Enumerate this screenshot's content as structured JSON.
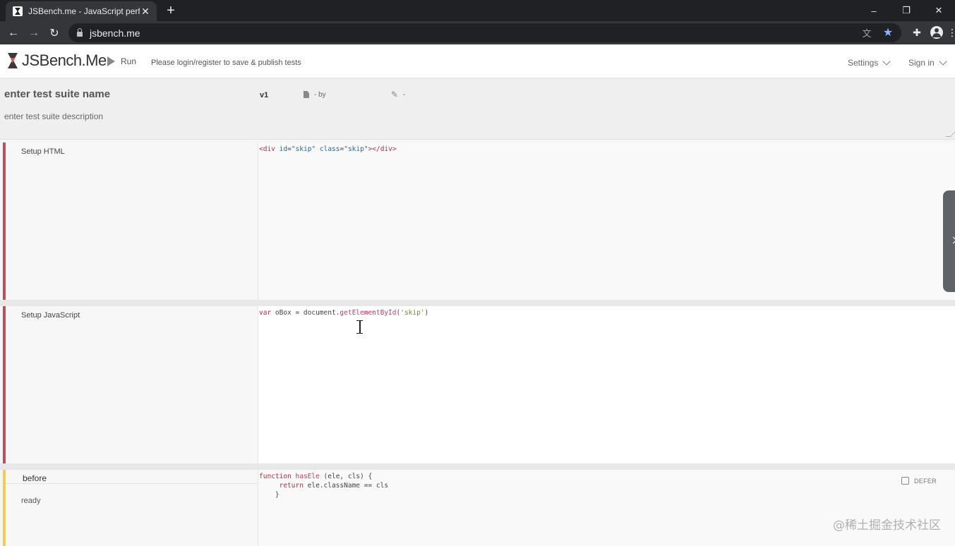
{
  "browser": {
    "tab_title": "JSBench.me - JavaScript perfo",
    "tab_close_glyph": "✕",
    "new_tab_glyph": "+",
    "url": "jsbench.me",
    "window_controls": [
      "–",
      "❐",
      "✕"
    ]
  },
  "app": {
    "logo_text": "JSBench.Me",
    "run_label": "Run",
    "login_hint": "Please login/register to save & publish tests",
    "settings_label": "Settings",
    "signin_label": "Sign in"
  },
  "suite": {
    "name_placeholder": "enter test suite name",
    "description_placeholder": "enter test suite description",
    "version": "v1",
    "by_text": "- by",
    "edit_text": "-"
  },
  "sections": {
    "setup_html": {
      "label": "Setup HTML",
      "code_html": "<span class=\"tk-tag\">&lt;div</span> <span class=\"tk-attr\">id</span>=<span class=\"tk-str\">\"skip\"</span> <span class=\"tk-attr\">class</span>=<span class=\"tk-str\">\"skip\"</span><span class=\"tk-tag\">&gt;&lt;/div&gt;</span>"
    },
    "setup_js": {
      "label": "Setup JavaScript",
      "code_html": "<span class=\"tk-kw\">var</span> oBox = document.<span class=\"tk-fn\">getElementById</span>(<span class=\"tk-str2\">'skip'</span>)"
    },
    "before": {
      "title": "before",
      "status": "ready",
      "defer_label": "DEFER",
      "code_html": "<span class=\"tk-kw\">function</span> <span class=\"tk-fn\">hasEle</span> (ele, cls) {\n     <span class=\"tk-kw\">return</span> ele.className == cls\n    }"
    }
  },
  "watermark": "@稀土掘金技术社区",
  "colors": {
    "setup_accent": "#b5525d",
    "before_accent": "#f0cc55",
    "star": "#8ab4f8"
  }
}
